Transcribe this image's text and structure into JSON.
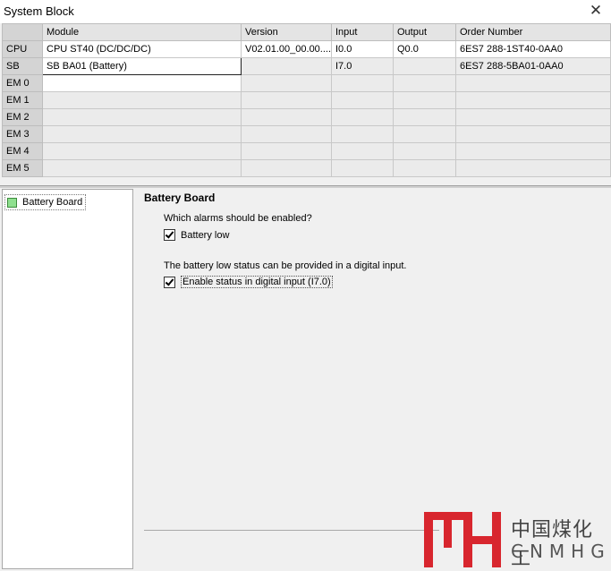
{
  "window": {
    "title": "System Block",
    "close_glyph": "✕"
  },
  "grid": {
    "headers": [
      "Module",
      "Version",
      "Input",
      "Output",
      "Order Number"
    ],
    "rows": [
      {
        "slot": "CPU",
        "module": "CPU ST40 (DC/DC/DC)",
        "version": "V02.01.00_00.00....",
        "input": "I0.0",
        "output": "Q0.0",
        "order": "6ES7 288-1ST40-0AA0"
      },
      {
        "slot": "SB",
        "module": "SB BA01 (Battery)",
        "version": "",
        "input": "I7.0",
        "output": "",
        "order": "6ES7 288-5BA01-0AA0"
      },
      {
        "slot": "EM 0",
        "module": "",
        "version": "",
        "input": "",
        "output": "",
        "order": ""
      },
      {
        "slot": "EM 1",
        "module": "",
        "version": "",
        "input": "",
        "output": "",
        "order": ""
      },
      {
        "slot": "EM 2",
        "module": "",
        "version": "",
        "input": "",
        "output": "",
        "order": ""
      },
      {
        "slot": "EM 3",
        "module": "",
        "version": "",
        "input": "",
        "output": "",
        "order": ""
      },
      {
        "slot": "EM 4",
        "module": "",
        "version": "",
        "input": "",
        "output": "",
        "order": ""
      },
      {
        "slot": "EM 5",
        "module": "",
        "version": "",
        "input": "",
        "output": "",
        "order": ""
      }
    ]
  },
  "tree": {
    "items": [
      {
        "label": "Battery Board",
        "icon": "green-square-icon"
      }
    ]
  },
  "panel": {
    "heading": "Battery Board",
    "alarms_question": "Which alarms should be enabled?",
    "battery_low_label": "Battery low",
    "battery_low_checked": true,
    "status_text": "The battery low status can be provided in a digital input.",
    "enable_status_label": "Enable status in digital input (I7.0)",
    "enable_status_checked": true
  },
  "watermark": {
    "logo_text": "MH",
    "cn_text": "中国煤化工",
    "en_text": "CNMHG"
  }
}
